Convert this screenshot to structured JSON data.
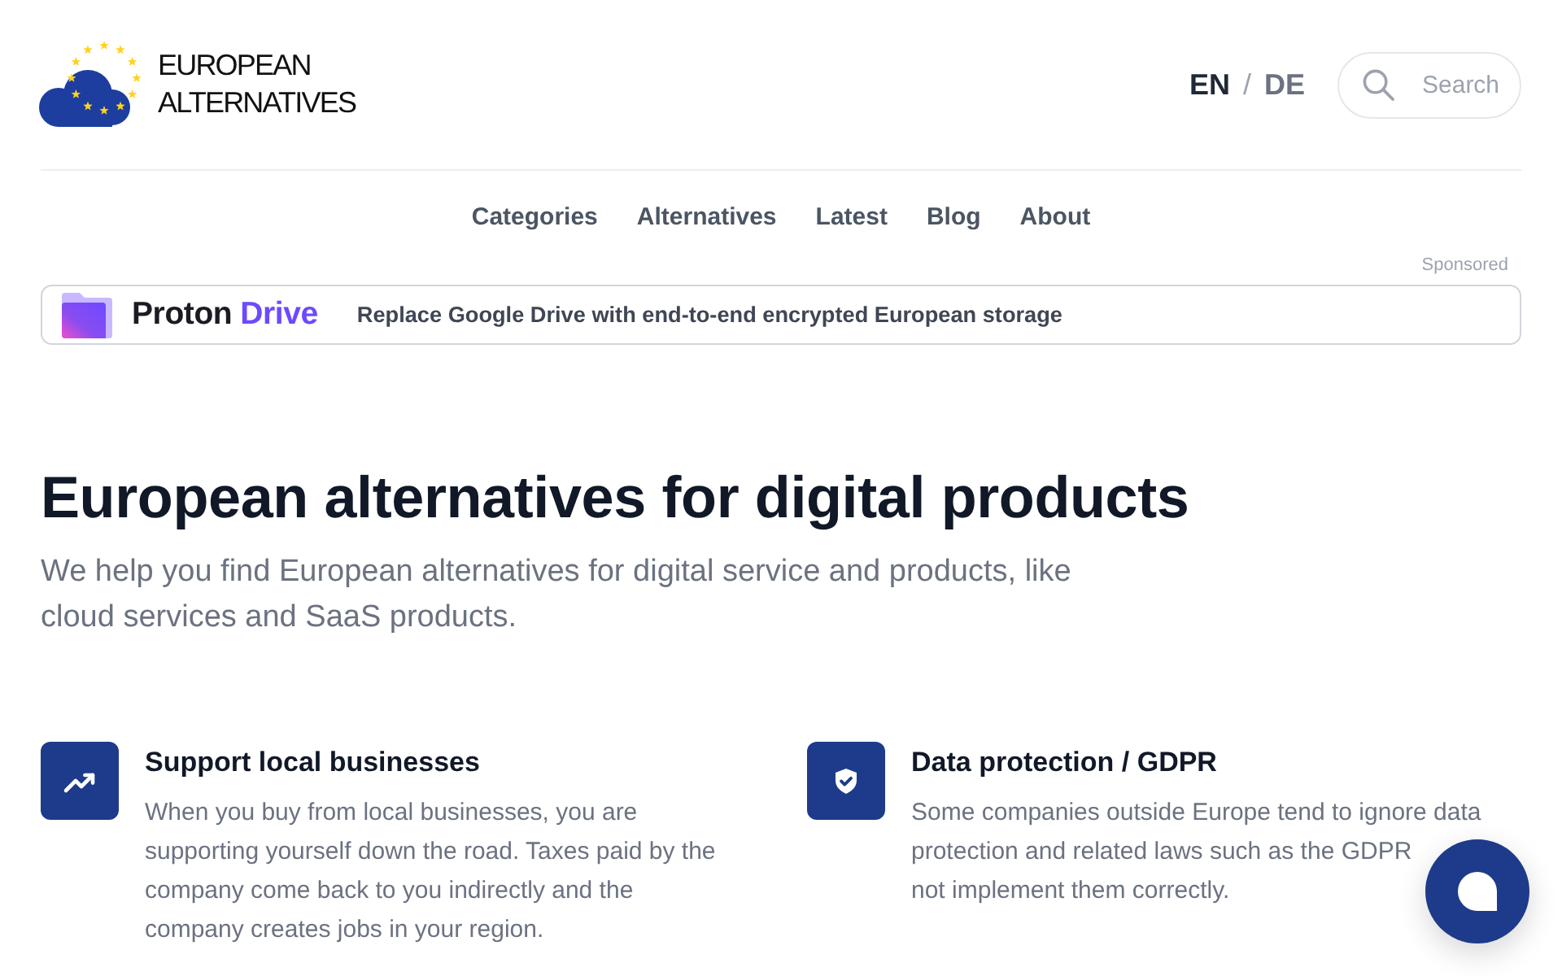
{
  "header": {
    "logo_text": [
      "EUROPEAN",
      "ALTERNATIVES"
    ],
    "languages": [
      {
        "label": "EN",
        "selected": true
      },
      {
        "label": "DE",
        "selected": false
      }
    ],
    "language_separator": "/",
    "search": {
      "placeholder": "Search"
    }
  },
  "nav": [
    "Categories",
    "Alternatives",
    "Latest",
    "Blog",
    "About"
  ],
  "sponsored_ad": {
    "label": "Sponsored",
    "brand": "Proton",
    "product": "Drive",
    "text": "Replace Google Drive with end-to-end encrypted European storage"
  },
  "hero": {
    "title": "European alternatives for digital products",
    "subtitle": "We help you find European alternatives for digital service and products, like cloud services and SaaS products."
  },
  "features": [
    {
      "kind": "trending",
      "title": "Support local businesses",
      "description_lines": [
        "When you buy from local businesses, you are",
        "supporting yourself down the road. Taxes paid by the",
        "company come back to you indirectly and the",
        "company creates jobs in your region."
      ]
    },
    {
      "kind": "shield",
      "title": "Data protection / GDPR",
      "description_lines": [
        "Some companies outside Europe tend to ignore data",
        "protection and related laws such as the GDPR",
        "not implement them correctly."
      ]
    }
  ]
}
